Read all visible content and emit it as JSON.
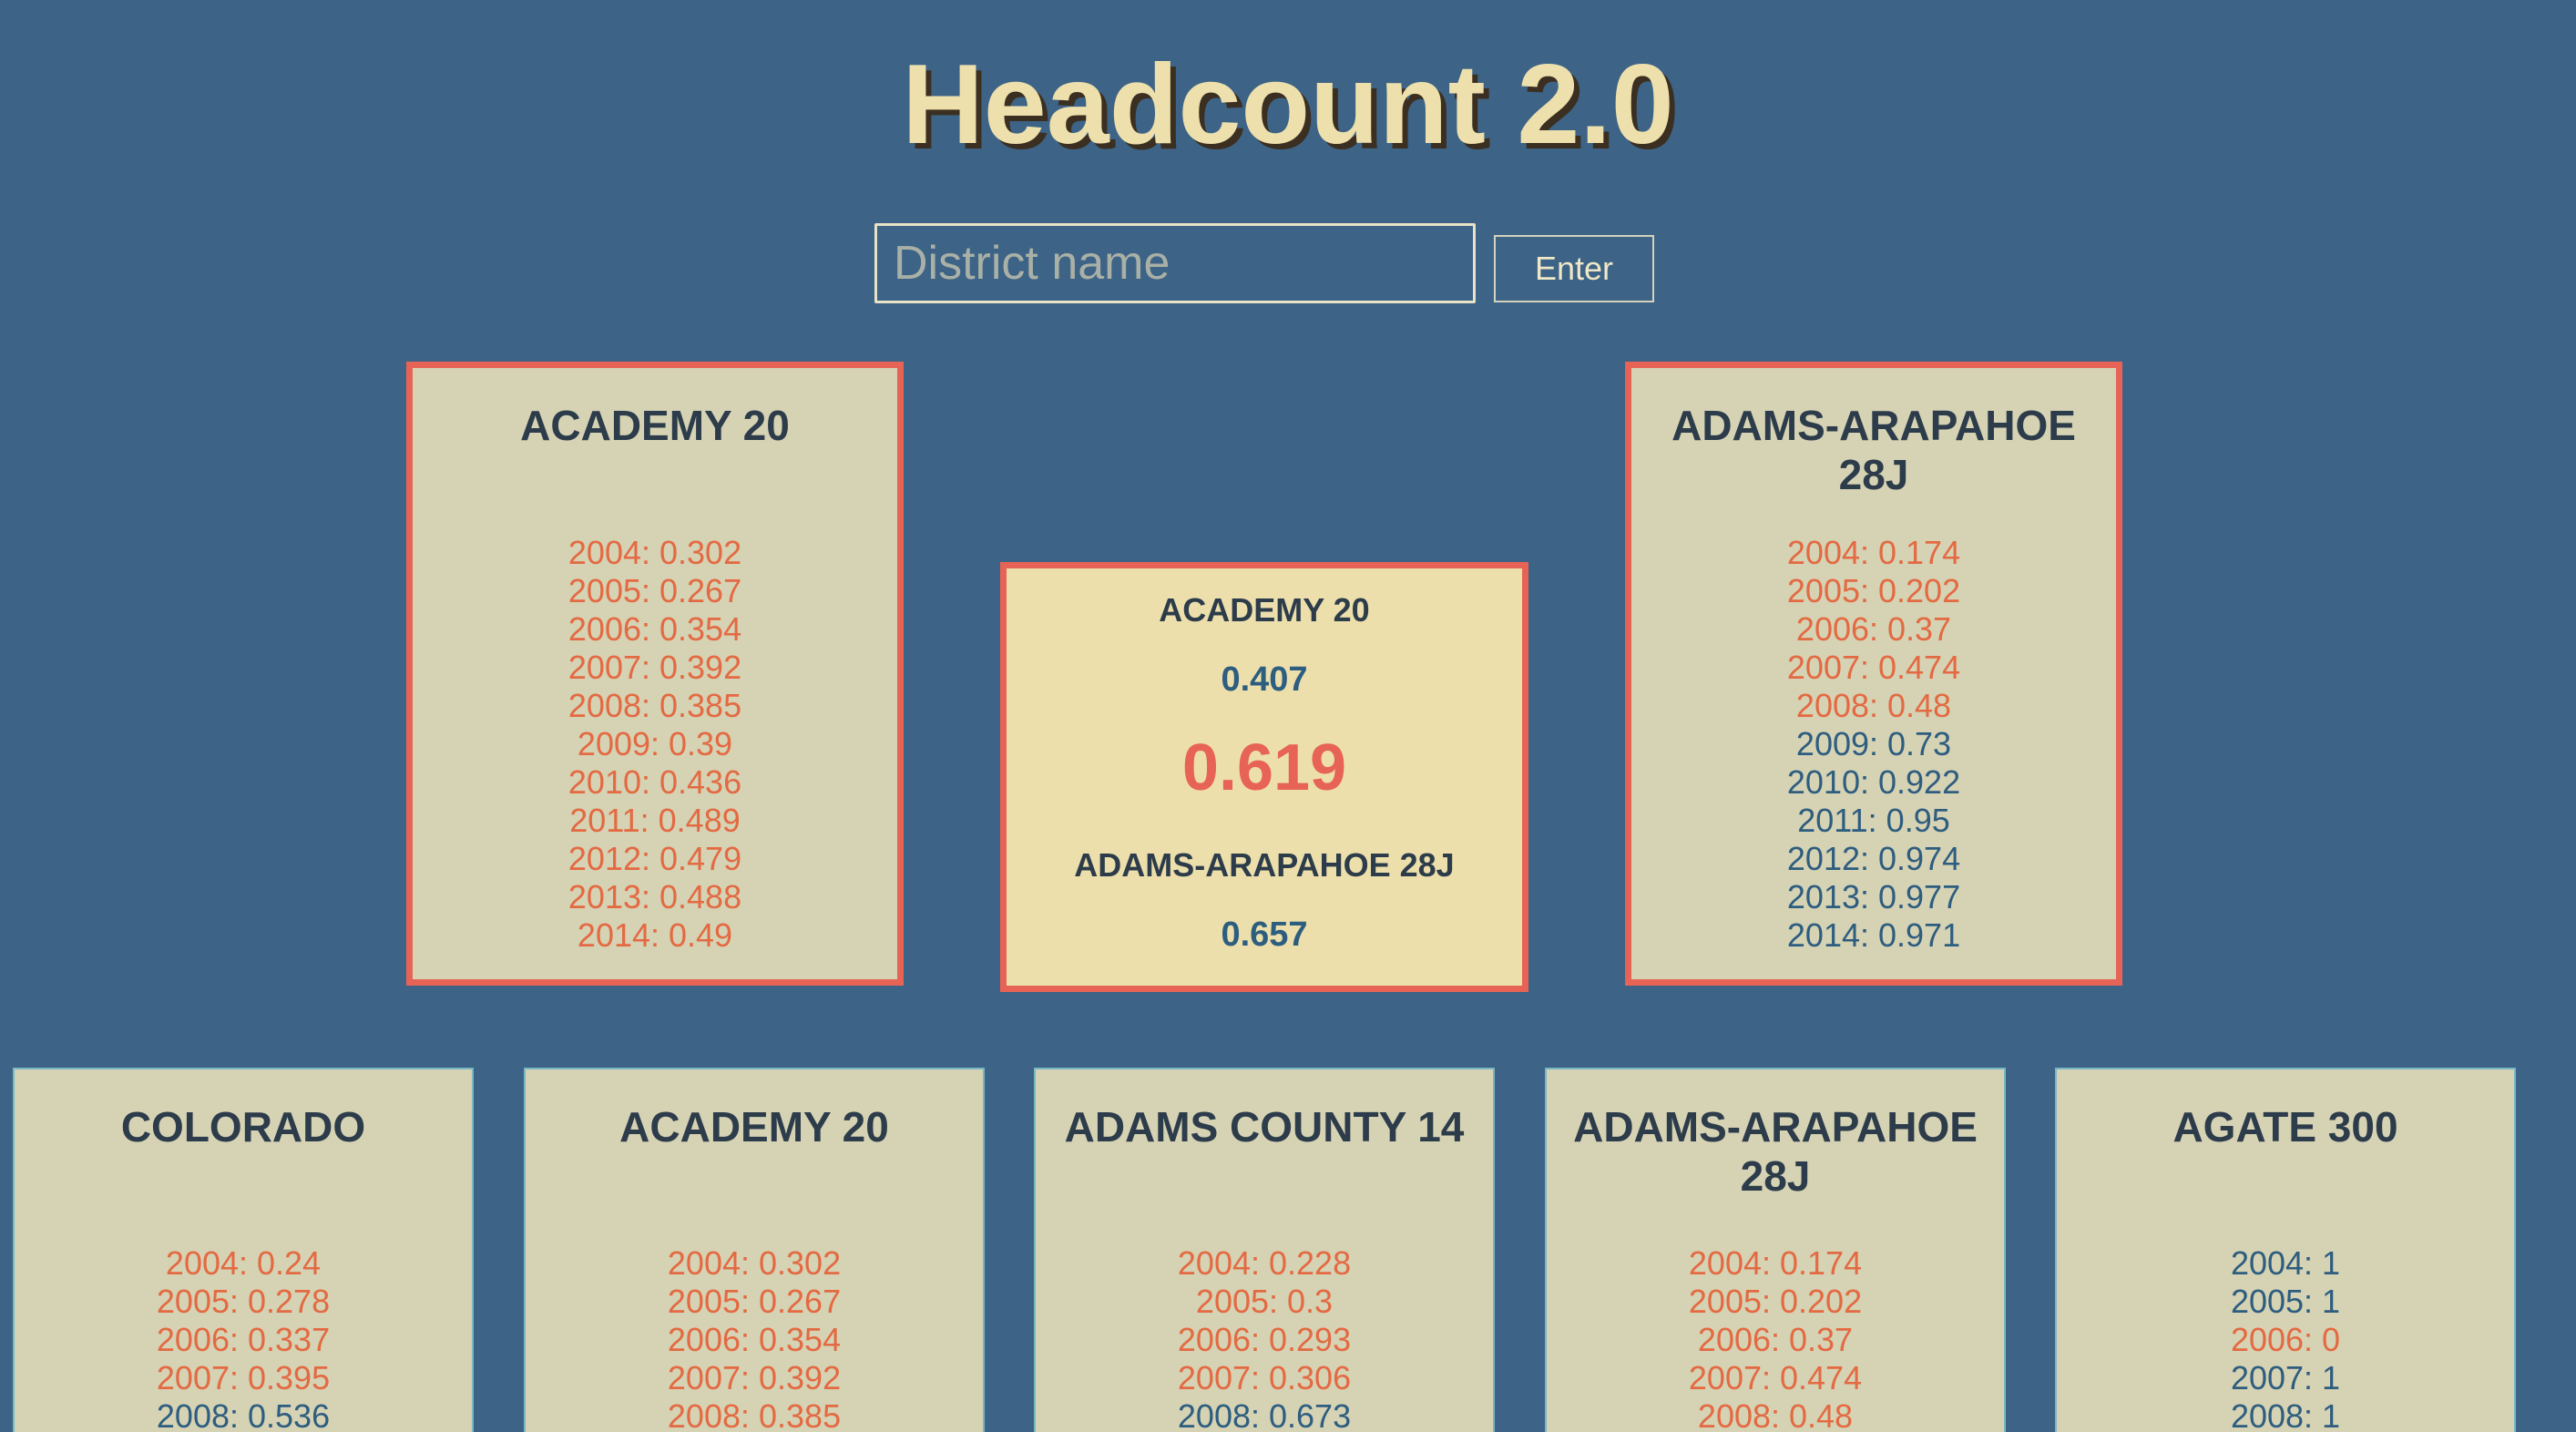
{
  "app": {
    "title": "Headcount 2.0"
  },
  "search": {
    "placeholder": "District name",
    "value": "",
    "button_label": "Enter"
  },
  "colors": {
    "background": "#3d6387",
    "selected_border": "#e76355",
    "below_threshold": "#e36a42",
    "above_threshold": "#2d5d7f",
    "card_bg": "#d6d2b4",
    "compare_bg": "#ecdfab"
  },
  "selected": [
    {
      "name": "ACADEMY 20",
      "years": [
        {
          "label": "2004: 0.302",
          "level": "low"
        },
        {
          "label": "2005: 0.267",
          "level": "low"
        },
        {
          "label": "2006: 0.354",
          "level": "low"
        },
        {
          "label": "2007: 0.392",
          "level": "low"
        },
        {
          "label": "2008: 0.385",
          "level": "low"
        },
        {
          "label": "2009: 0.39",
          "level": "low"
        },
        {
          "label": "2010: 0.436",
          "level": "low"
        },
        {
          "label": "2011: 0.489",
          "level": "low"
        },
        {
          "label": "2012: 0.479",
          "level": "low"
        },
        {
          "label": "2013: 0.488",
          "level": "low"
        },
        {
          "label": "2014: 0.49",
          "level": "low"
        }
      ]
    },
    {
      "name": "ADAMS-ARAPAHOE 28J",
      "years": [
        {
          "label": "2004: 0.174",
          "level": "low"
        },
        {
          "label": "2005: 0.202",
          "level": "low"
        },
        {
          "label": "2006: 0.37",
          "level": "low"
        },
        {
          "label": "2007: 0.474",
          "level": "low"
        },
        {
          "label": "2008: 0.48",
          "level": "low"
        },
        {
          "label": "2009: 0.73",
          "level": "high"
        },
        {
          "label": "2010: 0.922",
          "level": "high"
        },
        {
          "label": "2011: 0.95",
          "level": "high"
        },
        {
          "label": "2012: 0.974",
          "level": "high"
        },
        {
          "label": "2013: 0.977",
          "level": "high"
        },
        {
          "label": "2014: 0.971",
          "level": "high"
        }
      ]
    }
  ],
  "comparison": {
    "first_name": "ACADEMY 20",
    "first_average": "0.407",
    "ratio": "0.619",
    "second_name": "ADAMS-ARAPAHOE 28J",
    "second_average": "0.657"
  },
  "districts": [
    {
      "name": "COLORADO",
      "years": [
        {
          "label": "2004: 0.24",
          "level": "low"
        },
        {
          "label": "2005: 0.278",
          "level": "low"
        },
        {
          "label": "2006: 0.337",
          "level": "low"
        },
        {
          "label": "2007: 0.395",
          "level": "low"
        },
        {
          "label": "2008: 0.536",
          "level": "high"
        }
      ]
    },
    {
      "name": "ACADEMY 20",
      "years": [
        {
          "label": "2004: 0.302",
          "level": "low"
        },
        {
          "label": "2005: 0.267",
          "level": "low"
        },
        {
          "label": "2006: 0.354",
          "level": "low"
        },
        {
          "label": "2007: 0.392",
          "level": "low"
        },
        {
          "label": "2008: 0.385",
          "level": "low"
        }
      ]
    },
    {
      "name": "ADAMS COUNTY 14",
      "years": [
        {
          "label": "2004: 0.228",
          "level": "low"
        },
        {
          "label": "2005: 0.3",
          "level": "low"
        },
        {
          "label": "2006: 0.293",
          "level": "low"
        },
        {
          "label": "2007: 0.306",
          "level": "low"
        },
        {
          "label": "2008: 0.673",
          "level": "high"
        }
      ]
    },
    {
      "name": "ADAMS-ARAPAHOE 28J",
      "years": [
        {
          "label": "2004: 0.174",
          "level": "low"
        },
        {
          "label": "2005: 0.202",
          "level": "low"
        },
        {
          "label": "2006: 0.37",
          "level": "low"
        },
        {
          "label": "2007: 0.474",
          "level": "low"
        },
        {
          "label": "2008: 0.48",
          "level": "low"
        }
      ]
    },
    {
      "name": "AGATE 300",
      "years": [
        {
          "label": "2004: 1",
          "level": "high"
        },
        {
          "label": "2005: 1",
          "level": "high"
        },
        {
          "label": "2006: 0",
          "level": "low"
        },
        {
          "label": "2007: 1",
          "level": "high"
        },
        {
          "label": "2008: 1",
          "level": "high"
        }
      ]
    }
  ]
}
